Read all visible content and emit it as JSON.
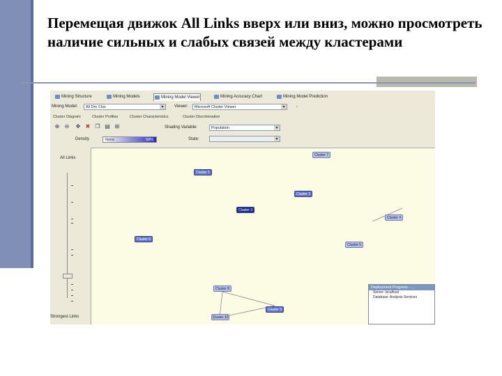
{
  "slide": {
    "title": "Перемещая движок All Links вверх или вниз, можно просмотреть наличие сильных и слабых связей между кластерами"
  },
  "app": {
    "tabs": [
      {
        "label": "Mining Structure",
        "active": false
      },
      {
        "label": "Mining Models",
        "active": false
      },
      {
        "label": "Mining Model Viewer",
        "active": true
      },
      {
        "label": "Mining Accuracy Chart",
        "active": false
      },
      {
        "label": "Mining Model Prediction",
        "active": false
      }
    ],
    "mining_model_label": "Mining Model:",
    "mining_model_value": "All Dm Clus",
    "viewer_label": "Viewer:",
    "viewer_value": "Microsoft Cluster Viewer",
    "subtabs": [
      "Cluster Diagram",
      "Cluster Profiles",
      "Cluster Characteristics",
      "Cluster Discrimination"
    ],
    "shading_variable_label": "Shading Variable:",
    "shading_variable_value": "Population",
    "density_label": "Density",
    "density_low": "None",
    "density_high": "58%",
    "state_label": "State:",
    "state_value": "",
    "slider_top_label": "All Links",
    "slider_bottom_label": "Strongest Links",
    "slider_position_fraction": 0.82,
    "clusters": [
      {
        "label": "Cluster 7",
        "shade": "light"
      },
      {
        "label": "Cluster 1",
        "shade": "mid"
      },
      {
        "label": "Cluster 2",
        "shade": "mid"
      },
      {
        "label": "Cluster 3",
        "shade": "dark"
      },
      {
        "label": "Cluster 4",
        "shade": "light"
      },
      {
        "label": "Cluster 6",
        "shade": "mid"
      },
      {
        "label": "Cluster 5",
        "shade": "light"
      },
      {
        "label": "Cluster 8",
        "shade": "light"
      },
      {
        "label": "Cluster 9",
        "shade": "mid"
      },
      {
        "label": "Cluster 10",
        "shade": "light"
      }
    ],
    "deployment": {
      "title": "Deployment Progress - ...",
      "lines": [
        "Server: localhost",
        "Database: Analysis Services"
      ]
    }
  },
  "colors": {
    "accent_bar": "#7f8fb8",
    "canvas_bg": "#fcfbe3",
    "node_dark": "#1c2a8c"
  }
}
